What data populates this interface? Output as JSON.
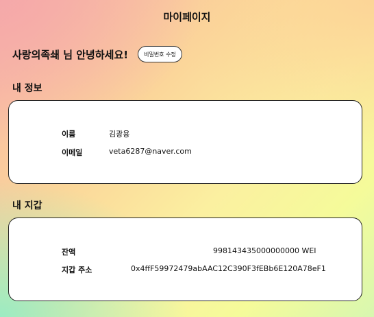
{
  "header": {
    "title": "마이페이지"
  },
  "greeting": {
    "text": "사랑의족쇄 님 안녕하세요!",
    "change_password_label": "비밀번호 수정"
  },
  "my_info": {
    "heading": "내 정보",
    "name_label": "이름",
    "name_value": "김광용",
    "email_label": "이메일",
    "email_value": "veta6287@naver.com"
  },
  "my_wallet": {
    "heading": "내 지갑",
    "balance_label": "잔액",
    "balance_value": "998143435000000000 WEI",
    "address_label": "지갑 주소",
    "address_value": "0x4ffF59972479abAAC12C390F3fEBb6E120A78eF1"
  }
}
